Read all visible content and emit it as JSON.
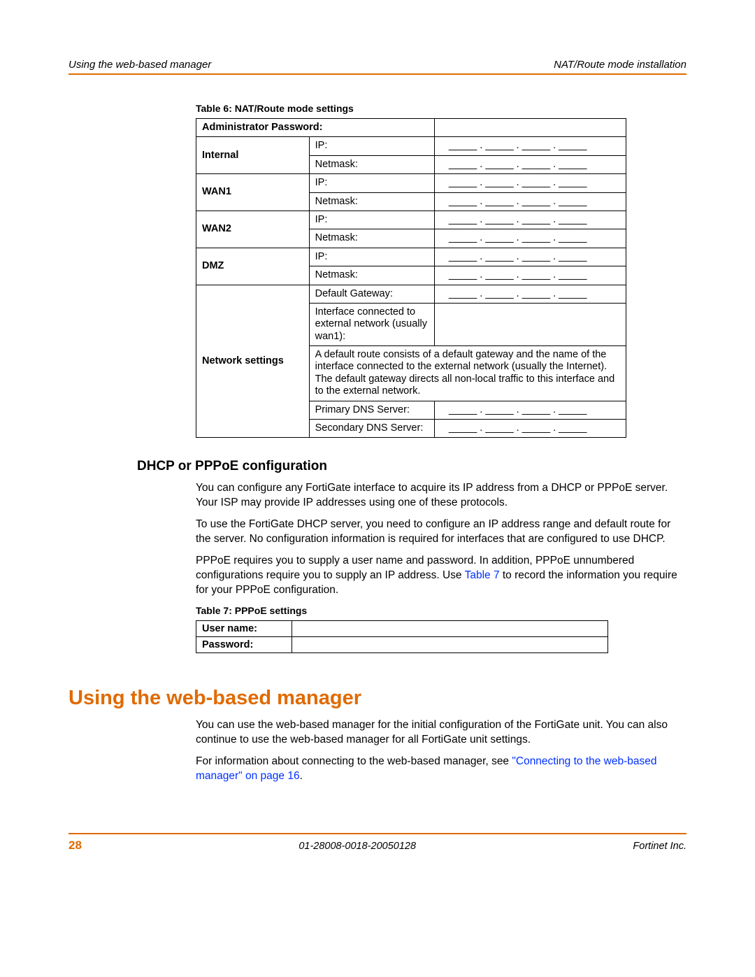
{
  "header": {
    "left": "Using the web-based manager",
    "right": "NAT/Route mode installation"
  },
  "table6": {
    "caption": "Table 6: NAT/Route mode settings",
    "admin_password": "Administrator Password:",
    "internal": "Internal",
    "wan1": "WAN1",
    "wan2": "WAN2",
    "dmz": "DMZ",
    "ip": "IP:",
    "netmask": "Netmask:",
    "network_settings": "Network settings",
    "default_gateway": "Default Gateway:",
    "interface_text": "Interface connected to external network (usually wan1):",
    "default_route_note": "A default route consists of a default gateway and the name of the interface connected to the external network (usually the Internet). The default gateway directs all non-local traffic to this interface and to the external network.",
    "primary_dns": "Primary DNS Server:",
    "secondary_dns": "Secondary DNS Server:",
    "blank": "_____ . _____ . _____ . _____"
  },
  "dhcp": {
    "heading": "DHCP or PPPoE configuration",
    "p1": "You can configure any FortiGate interface to acquire its IP address from a DHCP or PPPoE server. Your ISP may provide IP addresses using one of these protocols.",
    "p2": "To use the FortiGate DHCP server, you need to configure an IP address range and default route for the server. No configuration information is required for interfaces that are configured to use DHCP.",
    "p3a": "PPPoE requires you to supply a user name and password. In addition, PPPoE unnumbered configurations require you to supply an IP address. Use ",
    "p3_link": "Table 7",
    "p3b": " to record the information you require for your PPPoE configuration."
  },
  "table7": {
    "caption": "Table 7: PPPoE settings",
    "user": "User name:",
    "password": "Password:"
  },
  "main": {
    "heading": "Using the web-based manager",
    "p1": "You can use the web-based manager for the initial configuration of the FortiGate unit. You can also continue to use the web-based manager for all FortiGate unit settings.",
    "p2a": "For information about connecting to the web-based manager, see ",
    "p2_link": "\"Connecting to the web-based manager\" on page 16",
    "p2b": "."
  },
  "footer": {
    "page": "28",
    "center": "01-28008-0018-20050128",
    "right": "Fortinet Inc."
  }
}
